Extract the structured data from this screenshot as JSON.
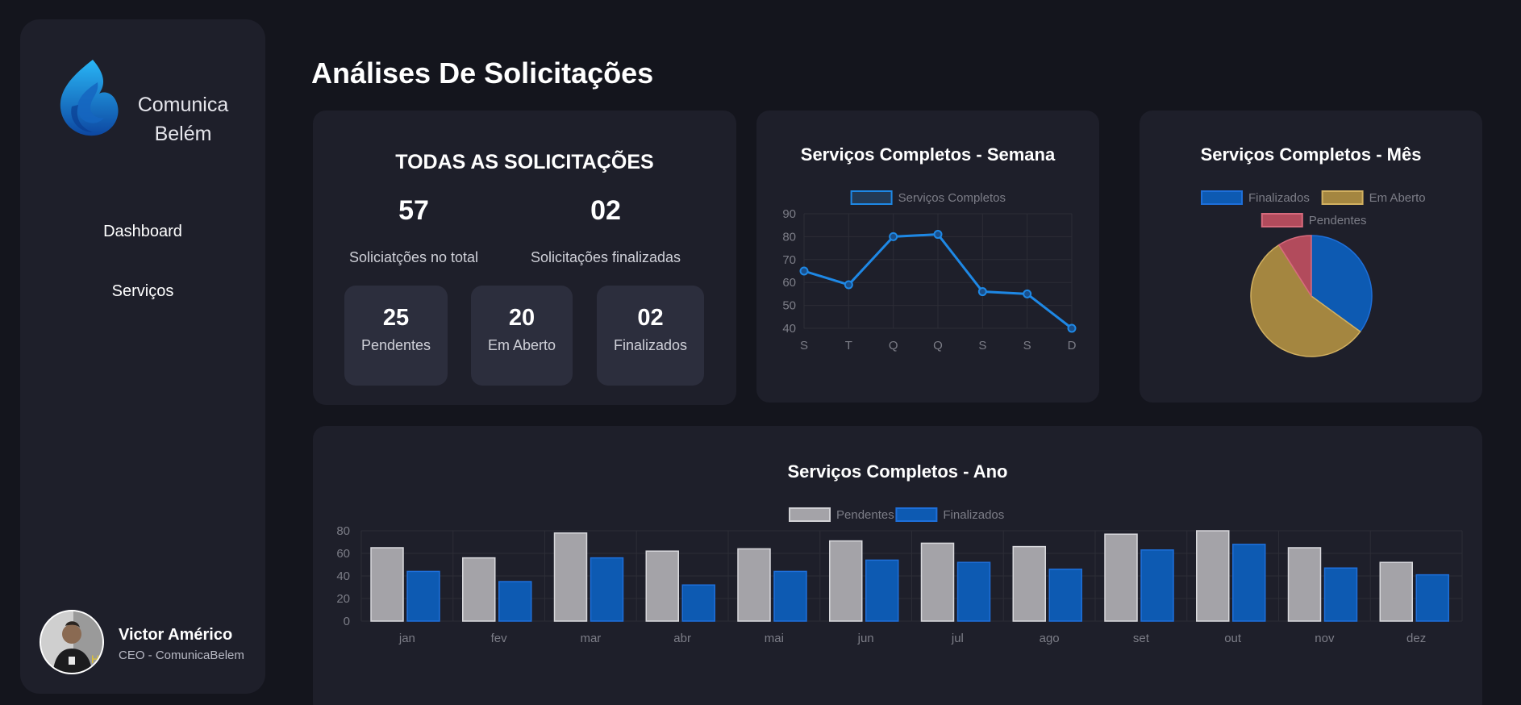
{
  "brand": {
    "name_line1": "Comunica",
    "name_line2": "Belém"
  },
  "sidebar": {
    "items": [
      {
        "label": "Dashboard"
      },
      {
        "label": "Serviços"
      }
    ]
  },
  "profile": {
    "name": "Victor Américo",
    "role": "CEO - ComunicaBelem"
  },
  "page": {
    "title": "Análises De Solicitações"
  },
  "summary": {
    "title": "TODAS AS SOLICITAÇÕES",
    "total": {
      "value": "57",
      "label": "Soliciatções no total"
    },
    "finalized": {
      "value": "02",
      "label": "Solicitações finalizadas"
    },
    "boxes": [
      {
        "value": "25",
        "label": "Pendentes"
      },
      {
        "value": "20",
        "label": "Em Aberto"
      },
      {
        "value": "02",
        "label": "Finalizados"
      }
    ]
  },
  "colors": {
    "line": "#1e88e5",
    "blue": "#0d5ab2",
    "gold": "#a48640",
    "red": "#b24b5c",
    "gray": "#a4a3a8",
    "grid": "#2c2d36",
    "tick": "#7c7d87"
  },
  "chart_data": [
    {
      "type": "line",
      "title": "Serviços Completos - Semana",
      "categories": [
        "S",
        "T",
        "Q",
        "Q",
        "S",
        "S",
        "D"
      ],
      "series": [
        {
          "name": "Serviços Completos",
          "values": [
            65,
            59,
            80,
            81,
            56,
            55,
            40
          ]
        }
      ],
      "ylim": [
        40,
        90
      ],
      "yticks": [
        40,
        50,
        60,
        70,
        80,
        90
      ],
      "grid": true,
      "legend": "top"
    },
    {
      "type": "pie",
      "title": "Serviços Completos - Mês",
      "categories": [
        "Finalizados",
        "Em Aberto",
        "Pendentes"
      ],
      "values": [
        35,
        56,
        9
      ],
      "legend": "top"
    },
    {
      "type": "bar",
      "title": "Serviços Completos - Ano",
      "categories": [
        "jan",
        "fev",
        "mar",
        "abr",
        "mai",
        "jun",
        "jul",
        "ago",
        "set",
        "out",
        "nov",
        "dez"
      ],
      "series": [
        {
          "name": "Pendentes",
          "values": [
            65,
            56,
            78,
            62,
            64,
            71,
            69,
            66,
            77,
            80,
            65,
            52
          ]
        },
        {
          "name": "Finalizados",
          "values": [
            44,
            35,
            56,
            32,
            44,
            54,
            52,
            46,
            63,
            68,
            47,
            41
          ]
        }
      ],
      "ylim": [
        0,
        80
      ],
      "yticks": [
        0,
        20,
        40,
        60,
        80
      ],
      "grid": true,
      "legend": "top"
    }
  ]
}
